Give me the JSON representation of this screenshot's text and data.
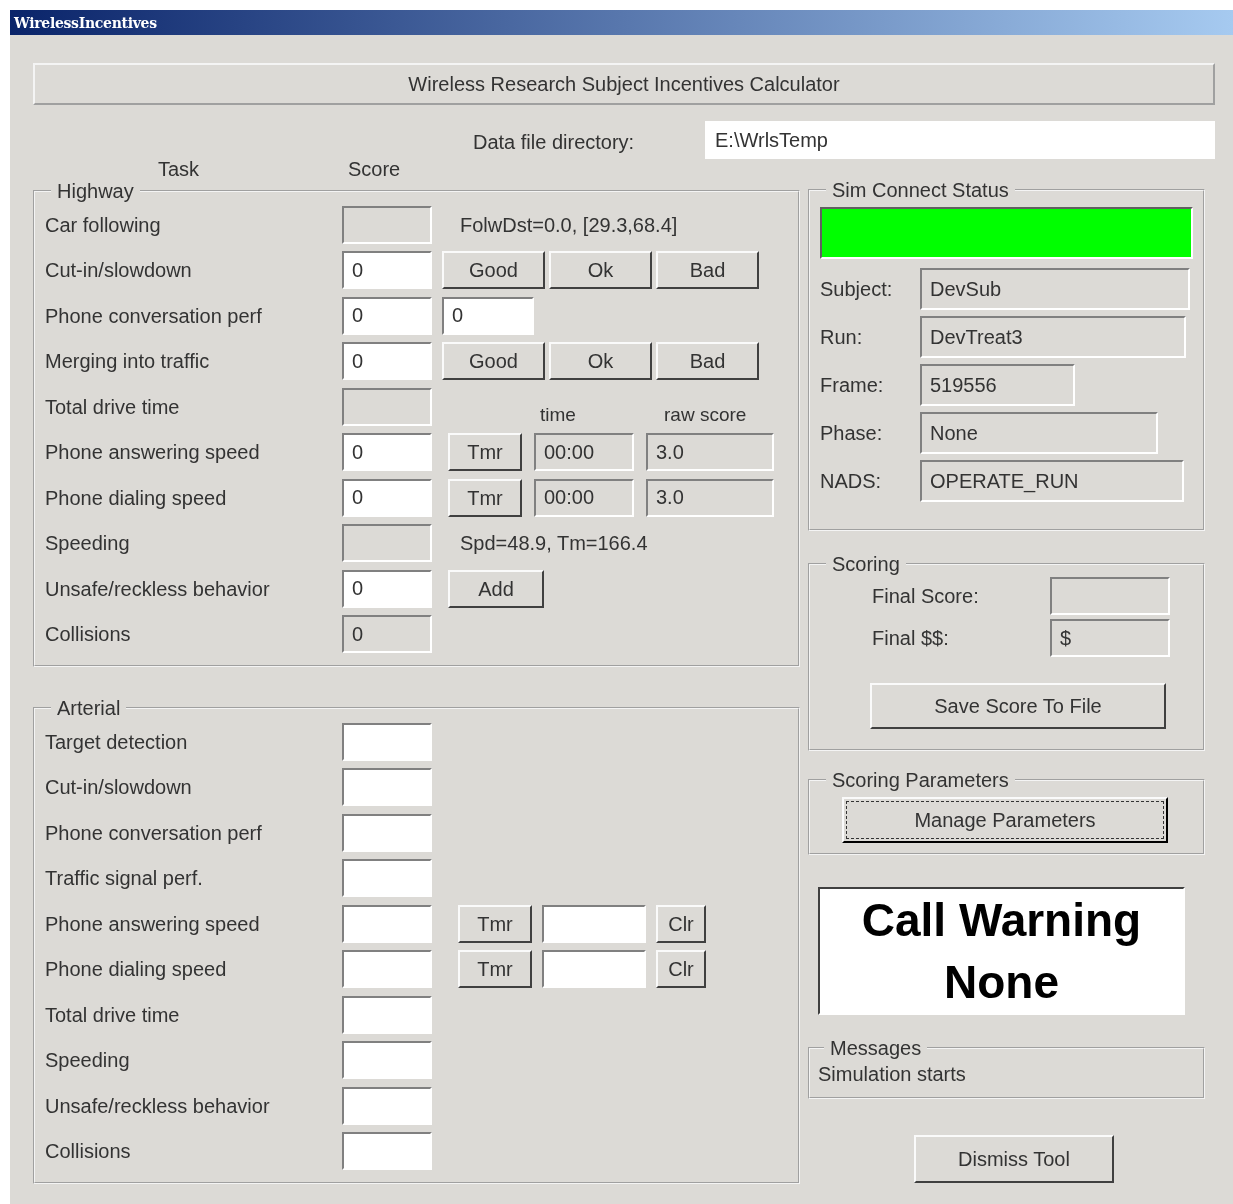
{
  "window": {
    "title": "WirelessIncentives"
  },
  "header": {
    "title": "Wireless Research Subject Incentives Calculator",
    "data_dir_label": "Data file directory:",
    "data_dir_value": "E:\\WrlsTemp"
  },
  "column_headers": [
    "Task",
    "Score"
  ],
  "highway": {
    "title": "Highway",
    "rows": [
      {
        "label": "Car following",
        "kind": "note",
        "score": {
          "disabled": true
        },
        "note": "FolwDst=0.0, [29.3,68.4]"
      },
      {
        "label": "Cut-in/slowdown",
        "kind": "rating",
        "score": {
          "value": "0",
          "disabled": false
        },
        "buttons": [
          "Good",
          "Ok",
          "Bad"
        ]
      },
      {
        "label": "Phone conversation perf",
        "kind": "extra_field",
        "score": {
          "value": "0",
          "disabled": false
        },
        "extra": "0"
      },
      {
        "label": "Merging into traffic",
        "kind": "rating",
        "score": {
          "value": "0",
          "disabled": false
        },
        "buttons": [
          "Good",
          "Ok",
          "Bad"
        ]
      },
      {
        "label": "Total drive time",
        "kind": "column_labels",
        "score": {
          "disabled": true
        },
        "column_labels": [
          "time",
          "raw score"
        ]
      },
      {
        "label": "Phone answering speed",
        "kind": "timer",
        "score": {
          "value": "0",
          "disabled": false
        },
        "button": "Tmr",
        "time": "00:00",
        "raw_score": "3.0"
      },
      {
        "label": "Phone dialing speed",
        "kind": "timer",
        "score": {
          "value": "0",
          "disabled": false
        },
        "button": "Tmr",
        "time": "00:00",
        "raw_score": "3.0"
      },
      {
        "label": "Speeding",
        "kind": "note",
        "score": {
          "disabled": true
        },
        "note": "Spd=48.9, Tm=166.4"
      },
      {
        "label": "Unsafe/reckless behavior",
        "kind": "add",
        "score": {
          "value": "0",
          "disabled": false
        },
        "button": "Add"
      },
      {
        "label": "Collisions",
        "kind": "plain",
        "score": {
          "value": "0",
          "disabled": true
        }
      }
    ]
  },
  "arterial": {
    "title": "Arterial",
    "rows": [
      {
        "label": "Target detection",
        "kind": "plain",
        "score": {
          "disabled": false
        }
      },
      {
        "label": "Cut-in/slowdown",
        "kind": "plain",
        "score": {
          "disabled": false
        }
      },
      {
        "label": "Phone conversation perf",
        "kind": "plain",
        "score": {
          "disabled": false
        }
      },
      {
        "label": "Traffic signal perf.",
        "kind": "plain",
        "score": {
          "disabled": false
        }
      },
      {
        "label": "Phone answering speed",
        "kind": "timer_clear",
        "score": {
          "disabled": false
        },
        "button": "Tmr",
        "clear_button": "Clr"
      },
      {
        "label": "Phone dialing speed",
        "kind": "timer_clear",
        "score": {
          "disabled": false
        },
        "button": "Tmr",
        "clear_button": "Clr"
      },
      {
        "label": "Total drive time",
        "kind": "plain",
        "score": {
          "disabled": false
        }
      },
      {
        "label": "Speeding",
        "kind": "plain",
        "score": {
          "disabled": false
        }
      },
      {
        "label": "Unsafe/reckless behavior",
        "kind": "plain",
        "score": {
          "disabled": false
        }
      },
      {
        "label": "Collisions",
        "kind": "plain",
        "score": {
          "disabled": false
        }
      }
    ]
  },
  "sim_connect": {
    "title": "Sim Connect Status",
    "status": {
      "color": "#00ff00"
    },
    "fields": [
      {
        "label": "Subject:",
        "value": "DevSub"
      },
      {
        "label": "Run:",
        "value": "DevTreat3"
      },
      {
        "label": "Frame:",
        "value": "519556"
      },
      {
        "label": "Phase:",
        "value": "None"
      },
      {
        "label": "NADS:",
        "value": "OPERATE_RUN"
      }
    ]
  },
  "scoring": {
    "title": "Scoring",
    "fields": [
      {
        "label": "Final Score:"
      },
      {
        "label": "Final $$:",
        "value": "$"
      }
    ],
    "button": "Save Score To File"
  },
  "scoring_parameters": {
    "title": "Scoring Parameters",
    "button": "Manage Parameters",
    "focused": true
  },
  "call_warning": [
    "Call Warning",
    "None"
  ],
  "messages": {
    "title": "Messages",
    "text": "Simulation starts"
  },
  "dismiss_button": "Dismiss Tool"
}
